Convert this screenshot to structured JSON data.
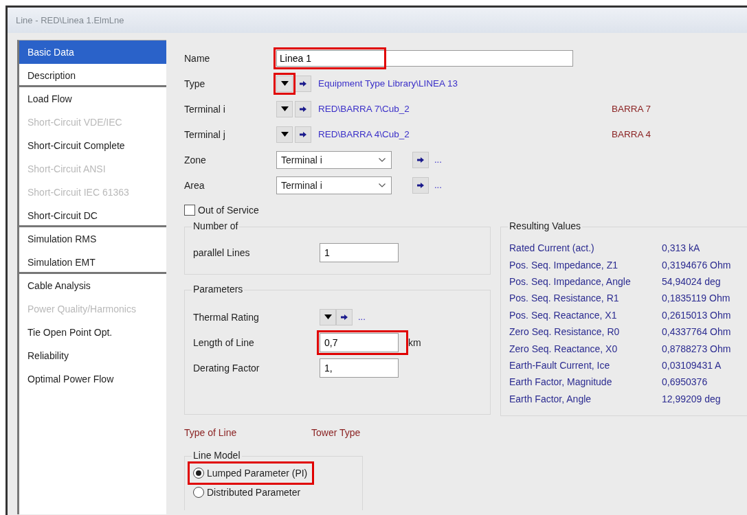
{
  "window": {
    "title": "Line - RED\\Linea 1.ElmLne"
  },
  "sidebar": {
    "items": [
      {
        "label": "Basic Data",
        "selected": true,
        "disabled": false,
        "group_end": false
      },
      {
        "label": "Description",
        "selected": false,
        "disabled": false,
        "group_end": true
      },
      {
        "label": "Load Flow",
        "selected": false,
        "disabled": false,
        "group_end": false
      },
      {
        "label": "Short-Circuit VDE/IEC",
        "selected": false,
        "disabled": true,
        "group_end": false
      },
      {
        "label": "Short-Circuit Complete",
        "selected": false,
        "disabled": false,
        "group_end": false
      },
      {
        "label": "Short-Circuit ANSI",
        "selected": false,
        "disabled": true,
        "group_end": false
      },
      {
        "label": "Short-Circuit IEC 61363",
        "selected": false,
        "disabled": true,
        "group_end": false
      },
      {
        "label": "Short-Circuit DC",
        "selected": false,
        "disabled": false,
        "group_end": true
      },
      {
        "label": "Simulation RMS",
        "selected": false,
        "disabled": false,
        "group_end": false
      },
      {
        "label": "Simulation EMT",
        "selected": false,
        "disabled": false,
        "group_end": true
      },
      {
        "label": "Cable Analysis",
        "selected": false,
        "disabled": false,
        "group_end": false
      },
      {
        "label": "Power Quality/Harmonics",
        "selected": false,
        "disabled": true,
        "group_end": false
      },
      {
        "label": "Tie Open Point Opt.",
        "selected": false,
        "disabled": false,
        "group_end": false
      },
      {
        "label": "Reliability",
        "selected": false,
        "disabled": false,
        "group_end": false
      },
      {
        "label": "Optimal Power Flow",
        "selected": false,
        "disabled": false,
        "group_end": false
      }
    ]
  },
  "name_field": {
    "label": "Name",
    "value": "Linea 1",
    "highlighted": true
  },
  "references": [
    {
      "label": "Type",
      "path": "Equipment Type Library\\LINEA 13",
      "highlighted": true
    },
    {
      "label": "Terminal i",
      "path": "RED\\BARRA 7\\Cub_2",
      "bus": "BARRA 7",
      "highlighted": false
    },
    {
      "label": "Terminal j",
      "path": "RED\\BARRA 4\\Cub_2",
      "bus": "BARRA 4",
      "highlighted": false
    }
  ],
  "selects": [
    {
      "label": "Zone",
      "value": "Terminal i",
      "more": "..."
    },
    {
      "label": "Area",
      "value": "Terminal i",
      "more": "..."
    }
  ],
  "out_of_service": {
    "label": "Out of Service",
    "checked": false
  },
  "number_group": {
    "title": "Number of",
    "label": "parallel Lines",
    "value": "1"
  },
  "parameters": {
    "title": "Parameters",
    "rows": [
      {
        "kind": "reference",
        "label": "Thermal Rating",
        "more": "..."
      },
      {
        "kind": "input",
        "label": "Length of Line",
        "value": "0,7",
        "unit": "km",
        "highlighted": true
      },
      {
        "kind": "input",
        "label": "Derating Factor",
        "value": "1,",
        "highlighted": false
      }
    ]
  },
  "links": [
    "Type of Line",
    "Tower Type"
  ],
  "line_model": {
    "title": "Line Model",
    "options": [
      {
        "label": "Lumped Parameter (PI)",
        "selected": true,
        "highlighted": true
      },
      {
        "label": "Distributed Parameter",
        "selected": false,
        "highlighted": false
      }
    ]
  },
  "results": {
    "title": "Resulting Values",
    "rows": [
      {
        "name": "Rated Current (act.)",
        "value": "0,313 kA"
      },
      {
        "name": "Pos. Seq. Impedance, Z1",
        "value": "0,3194676 Ohm"
      },
      {
        "name": "Pos. Seq. Impedance, Angle",
        "value": "54,94024 deg"
      },
      {
        "name": "Pos. Seq. Resistance, R1",
        "value": "0,1835119 Ohm"
      },
      {
        "name": "Pos. Seq. Reactance, X1",
        "value": "0,2615013 Ohm"
      },
      {
        "name": "Zero Seq. Resistance, R0",
        "value": "0,4337764 Ohm"
      },
      {
        "name": "Zero Seq. Reactance, X0",
        "value": "0,8788273 Ohm"
      },
      {
        "name": "Earth-Fault Current, Ice",
        "value": "0,03109431 A"
      },
      {
        "name": "Earth Factor, Magnitude",
        "value": "0,6950376"
      },
      {
        "name": "Earth Factor, Angle",
        "value": "12,99209 deg"
      }
    ]
  }
}
